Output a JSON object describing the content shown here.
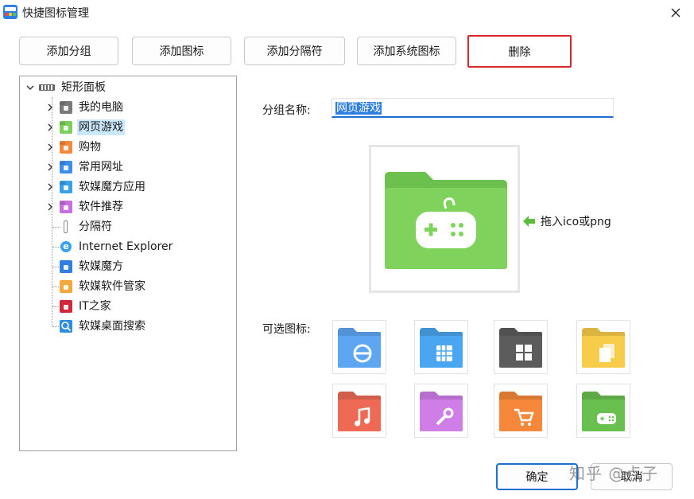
{
  "window": {
    "title": "快捷图标管理"
  },
  "toolbar": {
    "add_group": "添加分组",
    "add_icon": "添加图标",
    "add_separator": "添加分隔符",
    "add_system_icon": "添加系统图标",
    "delete": "删除"
  },
  "tree": {
    "root": "矩形面板",
    "items": [
      {
        "label": "我的电脑",
        "icon": "computer-folder-icon",
        "color": "#7a7a7a"
      },
      {
        "label": "网页游戏",
        "icon": "gamepad-folder-icon",
        "color": "#7ccf5a",
        "selected": true
      },
      {
        "label": "购物",
        "icon": "cart-folder-icon",
        "color": "#f5883a"
      },
      {
        "label": "常用网址",
        "icon": "ie-folder-icon",
        "color": "#3d8ee8"
      },
      {
        "label": "软媒魔方应用",
        "icon": "cube-folder-icon",
        "color": "#3aa0e8"
      },
      {
        "label": "软件推荐",
        "icon": "wrench-folder-icon",
        "color": "#c86ee0"
      },
      {
        "label": "分隔符",
        "icon": "separator-icon",
        "color": "#999999"
      },
      {
        "label": "Internet Explorer",
        "icon": "internet-explorer-icon",
        "color": "#2f8ee0"
      },
      {
        "label": "软媒魔方",
        "icon": "cube-icon",
        "color": "#2f7fe0"
      },
      {
        "label": "软媒软件管家",
        "icon": "software-manager-icon",
        "color": "#f2a83a"
      },
      {
        "label": "IT之家",
        "icon": "ithome-icon",
        "color": "#d0283a"
      },
      {
        "label": "软媒桌面搜索",
        "icon": "search-icon",
        "color": "#2f8ee0"
      }
    ]
  },
  "form": {
    "group_name_label": "分组名称:",
    "group_name_value": "网页游戏",
    "drag_hint": "拖入ico或png",
    "optional_icons_label": "可选图标:"
  },
  "optional_icons": [
    {
      "icon": "ie-folder-icon",
      "color": "#5ea6f2"
    },
    {
      "icon": "cube-folder-icon",
      "color": "#4aa6f0"
    },
    {
      "icon": "windows-folder-icon",
      "color": "#5c5c5c"
    },
    {
      "icon": "files-folder-icon",
      "color": "#f7cc4a"
    },
    {
      "icon": "music-folder-icon",
      "color": "#ee6a55"
    },
    {
      "icon": "wrench-folder-icon",
      "color": "#cf7ee8"
    },
    {
      "icon": "cart-folder-icon",
      "color": "#f5883a"
    },
    {
      "icon": "gamepad-folder-icon",
      "color": "#6ac04e"
    }
  ],
  "footer": {
    "ok": "确定",
    "cancel": "取消"
  },
  "watermark": "知乎 @点子"
}
